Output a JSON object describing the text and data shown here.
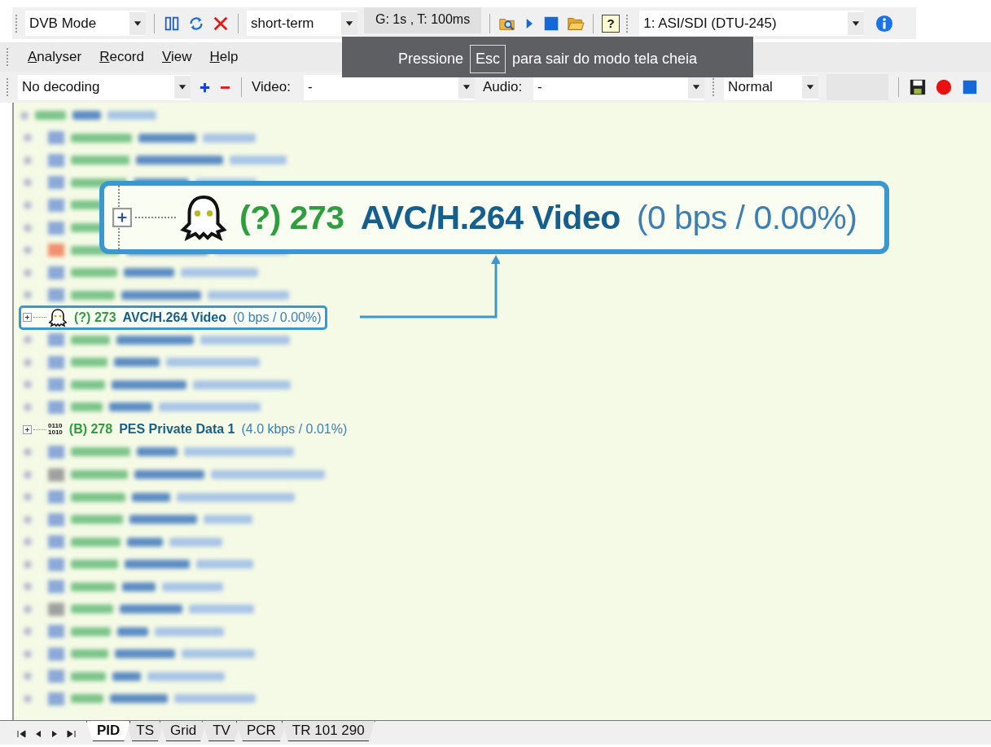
{
  "toolbar": {
    "mode_combo": "DVB Mode",
    "interval_combo": "short-term",
    "timing": "G: 1s , T: 100ms",
    "help_glyph": "?",
    "input_combo": "1: ASI/SDI (DTU-245)"
  },
  "menu": [
    "Analyser",
    "Record",
    "View",
    "Help"
  ],
  "decoder_bar": {
    "decoding_combo": "No decoding",
    "video_label": "Video:",
    "video_combo": "-",
    "audio_label": "Audio:",
    "audio_combo": "-",
    "speed_combo": "Normal"
  },
  "fullscreen_notice": {
    "before": "Pressione",
    "key": "Esc",
    "after": "para sair do modo tela cheia"
  },
  "tree": {
    "rows": [
      {
        "kind": "blurred",
        "children": [
          {
            "kind": "blurred"
          },
          {
            "kind": "blurred"
          },
          {
            "kind": "blurred"
          },
          {
            "kind": "blurred"
          },
          {
            "kind": "blurred"
          },
          {
            "kind": "blurred"
          },
          {
            "kind": "blurred"
          },
          {
            "kind": "blurred"
          },
          {
            "kind": "video",
            "type_code": "(?)",
            "pid": "273",
            "name": "AVC/H.264 Video",
            "rate": "(0 bps / 0.00%)",
            "highlighted": true
          },
          {
            "kind": "blurred"
          },
          {
            "kind": "blurred"
          },
          {
            "kind": "blurred"
          },
          {
            "kind": "blurred"
          },
          {
            "kind": "data",
            "icon_text": [
              "0110",
              "1010"
            ],
            "type_code": "(B)",
            "pid": "278",
            "name": "PES Private Data 1",
            "rate": "(4.0 kbps / 0.01%)",
            "highlighted": false
          },
          {
            "kind": "blurred"
          },
          {
            "kind": "blurred"
          },
          {
            "kind": "blurred"
          },
          {
            "kind": "blurred"
          },
          {
            "kind": "blurred"
          },
          {
            "kind": "blurred"
          },
          {
            "kind": "blurred"
          },
          {
            "kind": "blurred"
          },
          {
            "kind": "blurred"
          },
          {
            "kind": "blurred"
          },
          {
            "kind": "blurred"
          },
          {
            "kind": "blurred"
          }
        ]
      }
    ]
  },
  "callout": {
    "type_code": "(?)",
    "pid": "273",
    "name": "AVC/H.264 Video",
    "rate": "(0 bps / 0.00%)"
  },
  "tabs": [
    {
      "label": "PID",
      "selected": true
    },
    {
      "label": "TS",
      "selected": false
    },
    {
      "label": "Grid",
      "selected": false
    },
    {
      "label": "TV",
      "selected": false
    },
    {
      "label": "PCR",
      "selected": false
    },
    {
      "label": "TR 101 290",
      "selected": false
    }
  ]
}
